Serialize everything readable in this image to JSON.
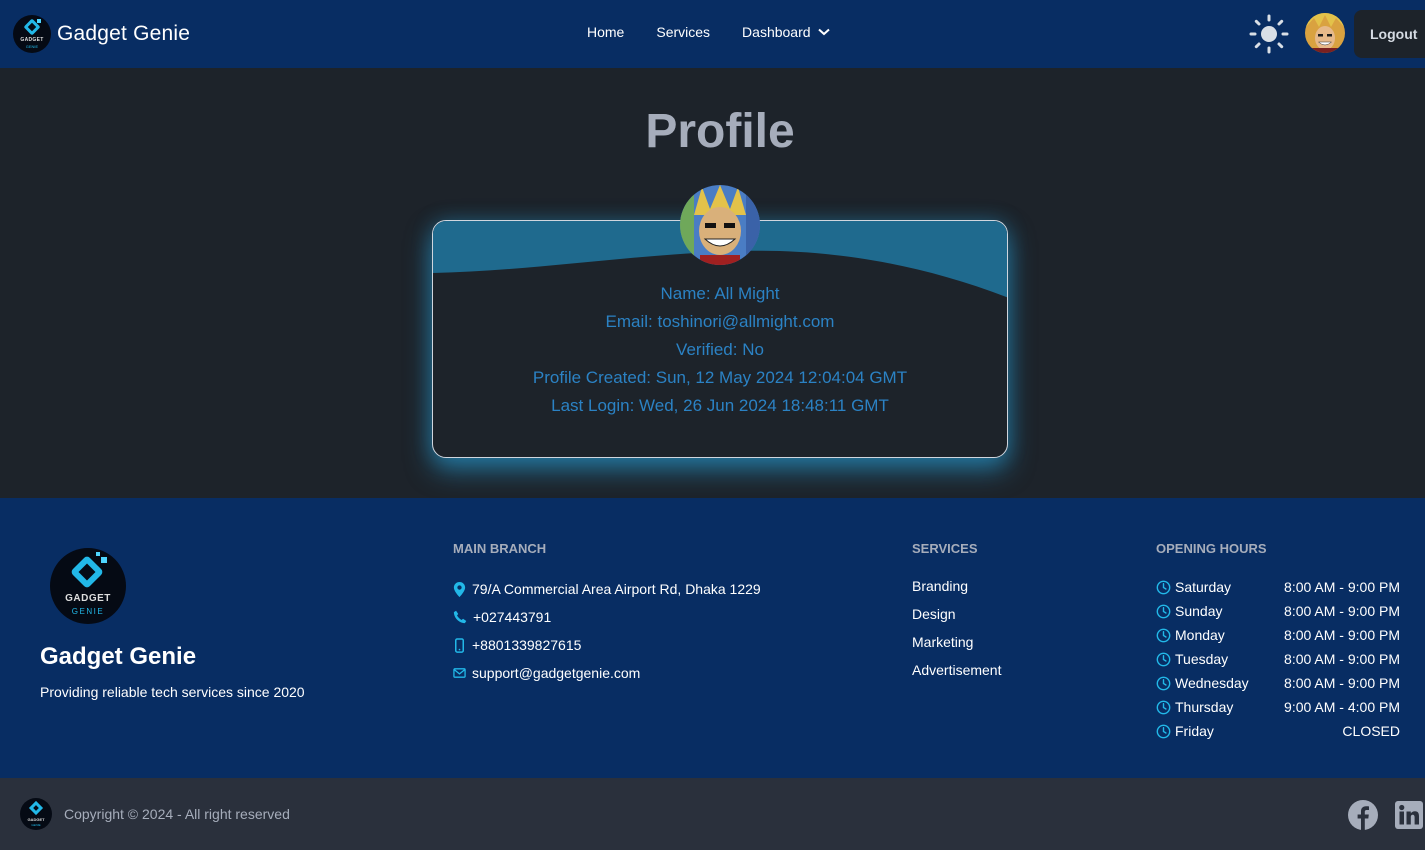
{
  "colors": {
    "navbar_bg": "#082d63",
    "page_bg": "#1d232a",
    "accent": "#22b8e8",
    "profile_text": "#2b82c4",
    "bottom_bar_bg": "#2a303c"
  },
  "navbar": {
    "brand": "Gadget Genie",
    "logo_text_top": "GADGET",
    "logo_text_bottom": "GENIE",
    "links": [
      "Home",
      "Services",
      "Dashboard"
    ],
    "theme_icon": "sun-icon",
    "logout_label": "Logout"
  },
  "profile": {
    "title": "Profile",
    "name": "Name: All Might",
    "email": "Email: toshinori@allmight.com",
    "verified": "Verified: No",
    "created": "Profile Created: Sun, 12 May 2024 12:04:04 GMT",
    "last_login": "Last Login: Wed, 26 Jun 2024 18:48:11 GMT"
  },
  "footer": {
    "brand": "Gadget Genie",
    "tagline": "Providing reliable tech services since 2020",
    "logo_text_top": "GADGET",
    "logo_text_bottom": "GENIE",
    "main_branch": {
      "heading": "MAIN BRANCH",
      "address": "79/A Commercial Area Airport Rd, Dhaka 1229",
      "phone": "+027443791",
      "mobile": "+8801339827615",
      "email": "support@gadgetgenie.com"
    },
    "services": {
      "heading": "SERVICES",
      "items": [
        "Branding",
        "Design",
        "Marketing",
        "Advertisement"
      ]
    },
    "hours": {
      "heading": "OPENING HOURS",
      "rows": [
        {
          "day": "Saturday",
          "time": "8:00 AM - 9:00 PM"
        },
        {
          "day": "Sunday",
          "time": "8:00 AM - 9:00 PM"
        },
        {
          "day": "Monday",
          "time": "8:00 AM - 9:00 PM"
        },
        {
          "day": "Tuesday",
          "time": "8:00 AM - 9:00 PM"
        },
        {
          "day": "Wednesday",
          "time": "8:00 AM - 9:00 PM"
        },
        {
          "day": "Thursday",
          "time": "9:00 AM - 4:00 PM"
        },
        {
          "day": "Friday",
          "time": "CLOSED"
        }
      ]
    }
  },
  "bottom_bar": {
    "copyright": "Copyright © 2024 - All right reserved",
    "social": [
      "facebook-icon",
      "linkedin-icon"
    ]
  }
}
